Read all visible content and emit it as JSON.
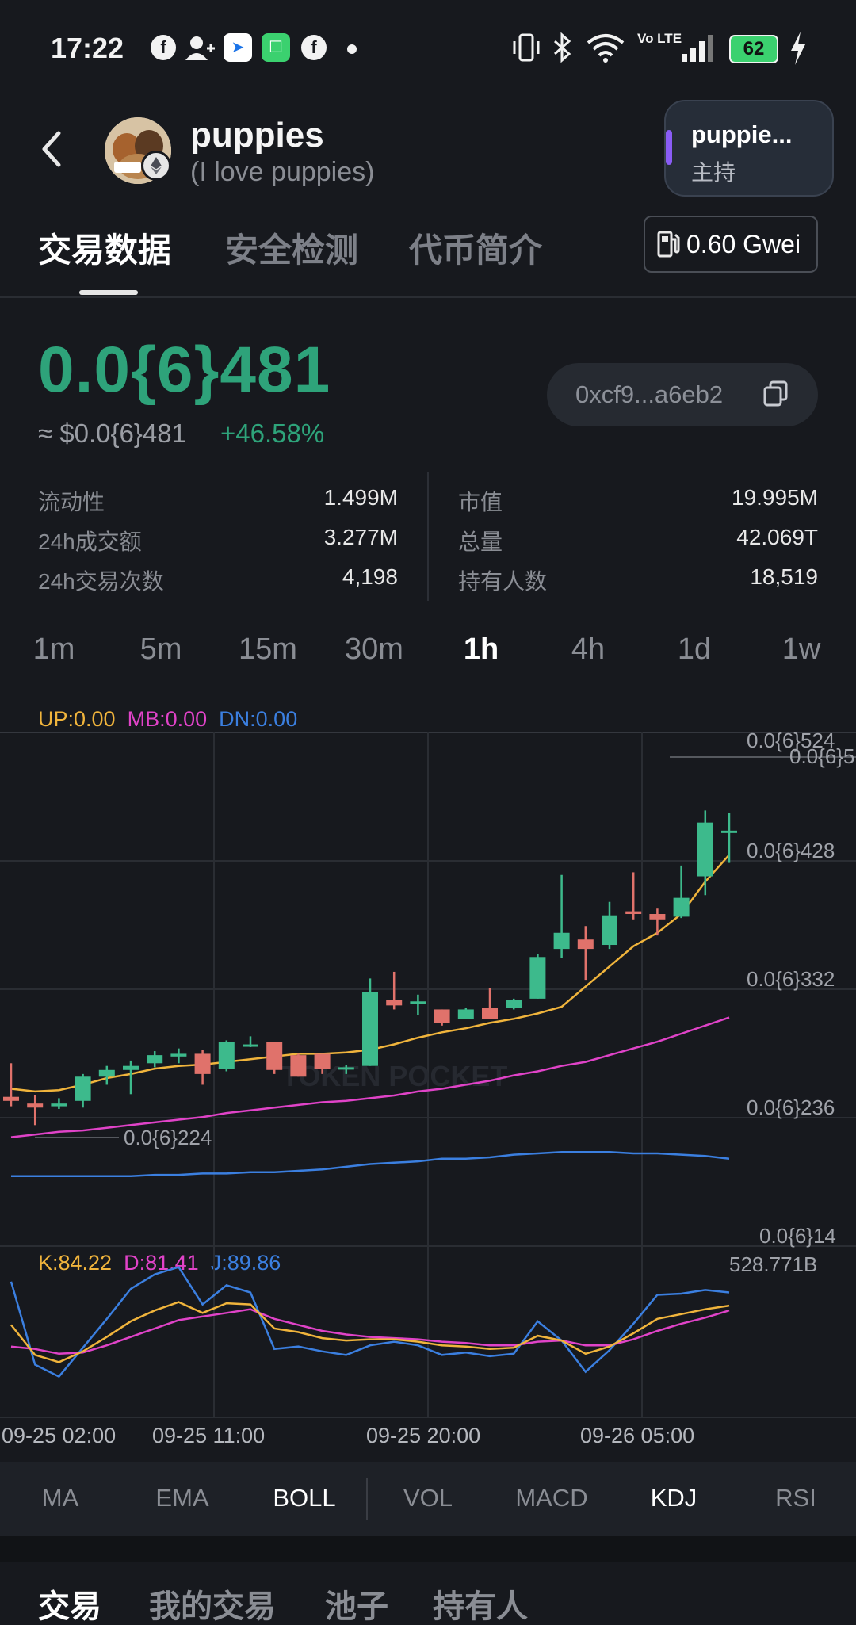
{
  "status_bar": {
    "time": "17:22",
    "battery": "62",
    "network": "Vo LTE",
    "icons": [
      "facebook-icon",
      "add-contact-icon",
      "app-icon",
      "android-icon",
      "facebook-icon",
      "dot-icon",
      "vibrate-icon",
      "bluetooth-icon",
      "wifi-icon",
      "signal-icon",
      "charging-icon"
    ]
  },
  "header": {
    "token_name": "puppies",
    "token_fullname": "(I love puppies)",
    "host_name": "puppie...",
    "host_role": "主持"
  },
  "tabs": {
    "items": [
      "交易数据",
      "安全检测",
      "代币简介"
    ],
    "active": "交易数据",
    "gas": "0.60 Gwei"
  },
  "price": {
    "main": "0.0{6}481",
    "usd": "≈ $0.0{6}481",
    "change": "+46.58%",
    "contract": "0xcf9...a6eb2"
  },
  "stats": {
    "left": [
      {
        "label": "流动性",
        "value": "1.499M"
      },
      {
        "label": "24h成交额",
        "value": "3.277M"
      },
      {
        "label": "24h交易次数",
        "value": "4,198"
      }
    ],
    "right": [
      {
        "label": "市值",
        "value": "19.995M"
      },
      {
        "label": "总量",
        "value": "42.069T"
      },
      {
        "label": "持有人数",
        "value": "18,519"
      }
    ]
  },
  "intervals": [
    "1m",
    "5m",
    "15m",
    "30m",
    "1h",
    "4h",
    "1d",
    "1w"
  ],
  "active_interval": "1h",
  "chart": {
    "boll_legend": {
      "up": "UP:0.00",
      "mb": "MB:0.00",
      "dn": "DN:0.00"
    },
    "kdj_legend": {
      "k": "K:84.22",
      "d": "D:81.41",
      "j": "J:89.86"
    },
    "price_axis": [
      "0.0{6}524",
      "0.0{6}428",
      "0.0{6}332",
      "0.0{6}236",
      "0.0{6}14"
    ],
    "high_label": "0.0{6}5",
    "low_label": "0.0{6}224",
    "volume_label": "528.771B",
    "watermark": "TOKEN POCKET",
    "dates": [
      "09-25 02:00",
      "09-25 11:00",
      "09-25 20:00",
      "09-26 05:00"
    ],
    "colors": {
      "up": "#3dba8c",
      "down": "#e0726b",
      "ma": "#f0b43c",
      "mid": "#e043c8",
      "low": "#3b7fe0"
    }
  },
  "chart_data": {
    "type": "candlestick",
    "candles": [
      {
        "o": 253,
        "c": 250,
        "h": 278,
        "l": 246
      },
      {
        "o": 248,
        "c": 245,
        "h": 254,
        "l": 232
      },
      {
        "o": 246,
        "c": 248,
        "h": 252,
        "l": 244
      },
      {
        "o": 250,
        "c": 268,
        "h": 270,
        "l": 245
      },
      {
        "o": 268,
        "c": 273,
        "h": 276,
        "l": 262
      },
      {
        "o": 273,
        "c": 276,
        "h": 280,
        "l": 255
      },
      {
        "o": 278,
        "c": 284,
        "h": 287,
        "l": 275
      },
      {
        "o": 283,
        "c": 285,
        "h": 289,
        "l": 278
      },
      {
        "o": 285,
        "c": 270,
        "h": 288,
        "l": 262
      },
      {
        "o": 274,
        "c": 294,
        "h": 295,
        "l": 272
      },
      {
        "o": 292,
        "c": 292,
        "h": 298,
        "l": 290
      },
      {
        "o": 294,
        "c": 273,
        "h": 294,
        "l": 270
      },
      {
        "o": 284,
        "c": 268,
        "h": 285,
        "l": 268
      },
      {
        "o": 285,
        "c": 274,
        "h": 285,
        "l": 270
      },
      {
        "o": 275,
        "c": 275,
        "h": 277,
        "l": 270
      },
      {
        "o": 276,
        "c": 331,
        "h": 341,
        "l": 276
      },
      {
        "o": 325,
        "c": 321,
        "h": 346,
        "l": 318
      },
      {
        "o": 324,
        "c": 324,
        "h": 329,
        "l": 314
      },
      {
        "o": 318,
        "c": 308,
        "h": 318,
        "l": 306
      },
      {
        "o": 311,
        "c": 318,
        "h": 319,
        "l": 311
      },
      {
        "o": 319,
        "c": 311,
        "h": 334,
        "l": 311
      },
      {
        "o": 319,
        "c": 325,
        "h": 326,
        "l": 318
      },
      {
        "o": 326,
        "c": 357,
        "h": 359,
        "l": 326
      },
      {
        "o": 363,
        "c": 375,
        "h": 418,
        "l": 356
      },
      {
        "o": 370,
        "c": 363,
        "h": 380,
        "l": 340
      },
      {
        "o": 366,
        "c": 388,
        "h": 398,
        "l": 363
      },
      {
        "o": 391,
        "c": 389,
        "h": 420,
        "l": 385
      },
      {
        "o": 389,
        "c": 385,
        "h": 393,
        "l": 373
      },
      {
        "o": 387,
        "c": 401,
        "h": 425,
        "l": 386
      },
      {
        "o": 417,
        "c": 457,
        "h": 466,
        "l": 403
      },
      {
        "o": 451,
        "c": 451,
        "h": 464,
        "l": 427
      }
    ],
    "ma_line": [
      259,
      257,
      258,
      262,
      267,
      270,
      274,
      276,
      277,
      279,
      281,
      283,
      285,
      285,
      286,
      288,
      292,
      297,
      301,
      304,
      308,
      311,
      315,
      320,
      335,
      350,
      365,
      375,
      389,
      413,
      433
    ],
    "boll_mid": [
      223,
      225,
      227,
      228,
      230,
      232,
      234,
      236,
      238,
      241,
      243,
      245,
      247,
      249,
      250,
      252,
      254,
      257,
      259,
      262,
      265,
      269,
      272,
      276,
      279,
      284,
      289,
      294,
      300,
      306,
      312
    ],
    "boll_low": [
      194,
      194,
      194,
      194,
      194,
      194,
      195,
      195,
      196,
      196,
      197,
      197,
      198,
      199,
      201,
      203,
      204,
      205,
      207,
      207,
      208,
      210,
      211,
      212,
      212,
      212,
      211,
      211,
      210,
      209,
      207
    ],
    "k": [
      65,
      40,
      34,
      43,
      55,
      68,
      77,
      84,
      75,
      83,
      82,
      62,
      59,
      54,
      52,
      53,
      53,
      51,
      48,
      47,
      45,
      46,
      56,
      52,
      41,
      47,
      58,
      70,
      74,
      78,
      81
    ],
    "d": [
      47,
      45,
      41,
      42,
      48,
      55,
      62,
      69,
      72,
      75,
      78,
      70,
      65,
      60,
      57,
      55,
      54,
      53,
      51,
      50,
      48,
      48,
      51,
      52,
      48,
      48,
      53,
      60,
      66,
      71,
      77
    ],
    "j": [
      101,
      32,
      22,
      46,
      70,
      95,
      107,
      113,
      82,
      98,
      92,
      45,
      47,
      43,
      40,
      48,
      51,
      48,
      40,
      42,
      39,
      41,
      68,
      52,
      26,
      44,
      66,
      90,
      91,
      94,
      92
    ]
  },
  "indicators": {
    "items": [
      "MA",
      "EMA",
      "BOLL",
      "VOL",
      "MACD",
      "KDJ",
      "RSI"
    ],
    "active": [
      "BOLL",
      "KDJ"
    ]
  },
  "bottom_tabs": {
    "items": [
      "交易",
      "我的交易",
      "池子",
      "持有人"
    ],
    "active": "交易"
  }
}
